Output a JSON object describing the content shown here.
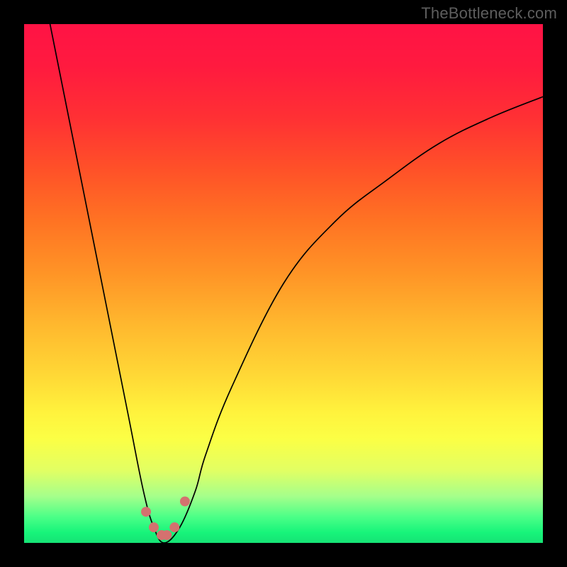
{
  "watermark": "TheBottleneck.com",
  "chart_data": {
    "type": "line",
    "title": "",
    "xlabel": "",
    "ylabel": "",
    "xlim": [
      0,
      100
    ],
    "ylim": [
      0,
      100
    ],
    "series": [
      {
        "name": "bottleneck-curve",
        "x": [
          5,
          10,
          15,
          20,
          23,
          25,
          27,
          30,
          33,
          35,
          40,
          50,
          60,
          70,
          80,
          90,
          100
        ],
        "values": [
          100,
          75,
          50,
          25,
          10,
          3,
          0,
          3,
          10,
          17,
          30,
          50,
          62,
          70,
          77,
          82,
          86
        ]
      }
    ],
    "markers": {
      "name": "highlight-dots",
      "x": [
        23.5,
        25,
        26.5,
        27.5,
        29,
        31
      ],
      "values": [
        6,
        3,
        1.5,
        1.5,
        3,
        8
      ]
    },
    "gradient_stops": [
      {
        "pos": 0,
        "color": "#ff1345"
      },
      {
        "pos": 50,
        "color": "#ff9426"
      },
      {
        "pos": 78,
        "color": "#fff33d"
      },
      {
        "pos": 96,
        "color": "#4bff87"
      },
      {
        "pos": 100,
        "color": "#16e275"
      }
    ]
  }
}
